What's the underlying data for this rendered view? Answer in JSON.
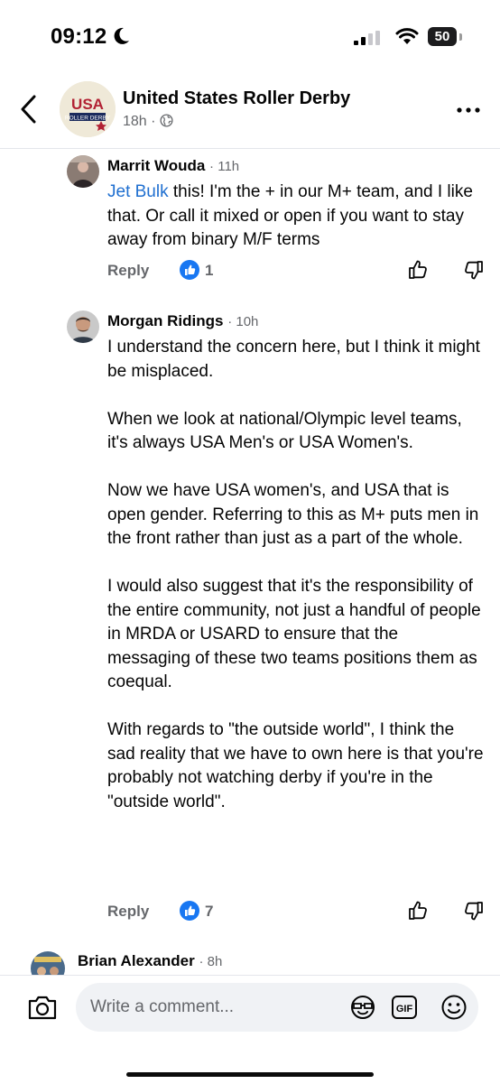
{
  "status_bar": {
    "time": "09:12",
    "battery": "50"
  },
  "header": {
    "page_name": "United States Roller Derby",
    "post_age": "18h",
    "separator": "·",
    "logo_text_top": "USA",
    "logo_text_bottom": "ROLLER DERBY"
  },
  "comments": [
    {
      "author": "Marrit Wouda",
      "time": "· 11h",
      "mention": "Jet Bulk",
      "body_after_mention": " this! I'm the + in our M+ team, and I like that. Or call it mixed or open if you want to stay away from binary M/F terms",
      "reply_label": "Reply",
      "likes": "1"
    },
    {
      "author": "Morgan Ridings",
      "time": "· 10h",
      "paragraphs": [
        "I understand the concern here, but I think it might be misplaced.",
        "When we look at national/Olympic level teams, it's always USA Men's or USA Women's.",
        "Now we have USA women's, and USA that is open gender. Referring to this as M+ puts men in the front rather than just as a part of the whole.",
        "I would also suggest that it's the responsibility of the entire community, not just a handful of people in MRDA or USARD to ensure that the messaging of these two teams positions them as coequal.",
        "With regards to \"the outside world\", I think the sad reality that we have to own here is that you're probably not watching derby if you're in the \"outside world\"."
      ],
      "reply_label": "Reply",
      "likes": "7"
    },
    {
      "author": "Brian Alexander",
      "time": "· 8h"
    }
  ],
  "composer": {
    "placeholder": "Write a comment...",
    "gif_label": "GIF"
  },
  "icons": {
    "back": "chevron-left-icon",
    "more": "more-horizontal-icon",
    "globe": "globe-icon",
    "like_badge": "like-badge-icon",
    "thumb_up": "thumbs-up-icon",
    "thumb_down": "thumbs-down-icon",
    "camera": "camera-icon",
    "sticker": "sticker-icon",
    "gif": "gif-icon",
    "emoji": "emoji-icon"
  },
  "colors": {
    "accent": "#1877f2",
    "mention": "#1f6fd0",
    "meta": "#65676b"
  }
}
